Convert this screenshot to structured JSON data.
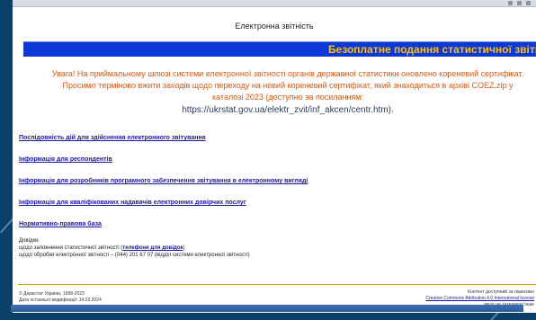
{
  "page": {
    "title": "Електронна звітність",
    "marquee": "Безоплатне подання статистичної звітн"
  },
  "notice": {
    "text": "Увага! На приймальному шлюзі системи електронної звітності органів державної статистики оновлено кореневий сертифікат. Просимо терміново вжити заходів щодо переходу на новий кореневий сертифікат, який знаходиться в архіві COEZ.zip у каталозі 2023 (доступно за посиланням:",
    "url": "https://ukrstat.gov.ua/elektr_zvit/inf_akcen/centr.htm)."
  },
  "links": [
    {
      "label": "Послідовність дій для здійснення електронного звітування"
    },
    {
      "label": "Інформація для респондентів"
    },
    {
      "label": "Інформація для розробників програмного забезпечення звітування в електронному вигляді"
    },
    {
      "label": "Інформація для кваліфікованих надавачів електронних довірчих послуг"
    },
    {
      "label": "Нормативно-правова база"
    }
  ],
  "contact": {
    "heading": "Довідки:",
    "line1_prefix": "щодо заповнення статистичної звітності (",
    "line1_link": "телефони для довідок",
    "line1_suffix": ")",
    "line2": "щодо обробки електронної звітності – (044) 201 67 07 (відділ системи електронної звітності)"
  },
  "footer": {
    "copyright": "© Держстат України, 1998-2023",
    "modified": "Дата останньої модифікації: 14.03.2024",
    "right_line1": "Контент доступний за ліцензією",
    "right_link": "Creative Commons Attribution 4.0 International license",
    "right_line3": "якщо не зазначено інше"
  },
  "colors": {
    "marquee_bg": "#0b38d6",
    "marquee_text": "#ffc000",
    "notice_text": "#d65a12",
    "link": "#1a1a9a"
  }
}
